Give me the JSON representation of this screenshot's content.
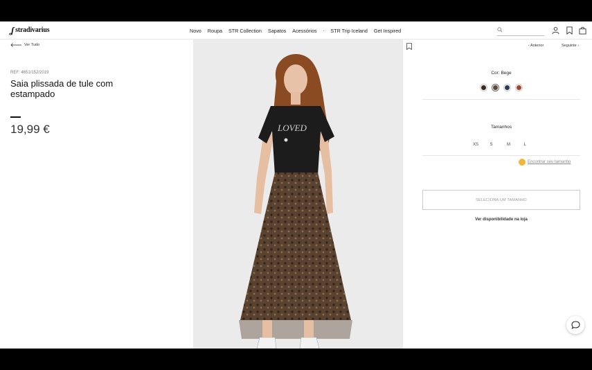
{
  "header": {
    "brand": "stradivarius",
    "nav": [
      "Novo",
      "Roupa",
      "STR Collection",
      "Sapatos",
      "Acessórios",
      "STR Trip Iceland",
      "Get Inspired"
    ],
    "nav_dot": "."
  },
  "product": {
    "back_label": "Ver Tudo",
    "ref": "REF: 4651/152/2019",
    "title": "Saia plissada de tule com estampado",
    "price": "19,99 €"
  },
  "pager": {
    "prev_label": "‹ Anterior",
    "next_label": "Seguinte ›"
  },
  "options": {
    "color_label": "Cor: Bege",
    "colors": [
      {
        "name": "swatch-1",
        "hex": "#3a2a22"
      },
      {
        "name": "swatch-2",
        "hex": "#5b4a3c"
      },
      {
        "name": "swatch-3",
        "hex": "#2e3a5a"
      },
      {
        "name": "swatch-4",
        "hex": "#a0452e"
      }
    ],
    "sizes_label": "Tamanhos",
    "sizes": [
      "XS",
      "S",
      "M",
      "L"
    ],
    "find_size": "Encontrar seu tamanho",
    "select_button": "SELECIONA UM TAMANHO",
    "availability": "Ver disponibilidade na loja"
  },
  "colors": {
    "accent": "#f0b63c",
    "text": "#222222"
  }
}
